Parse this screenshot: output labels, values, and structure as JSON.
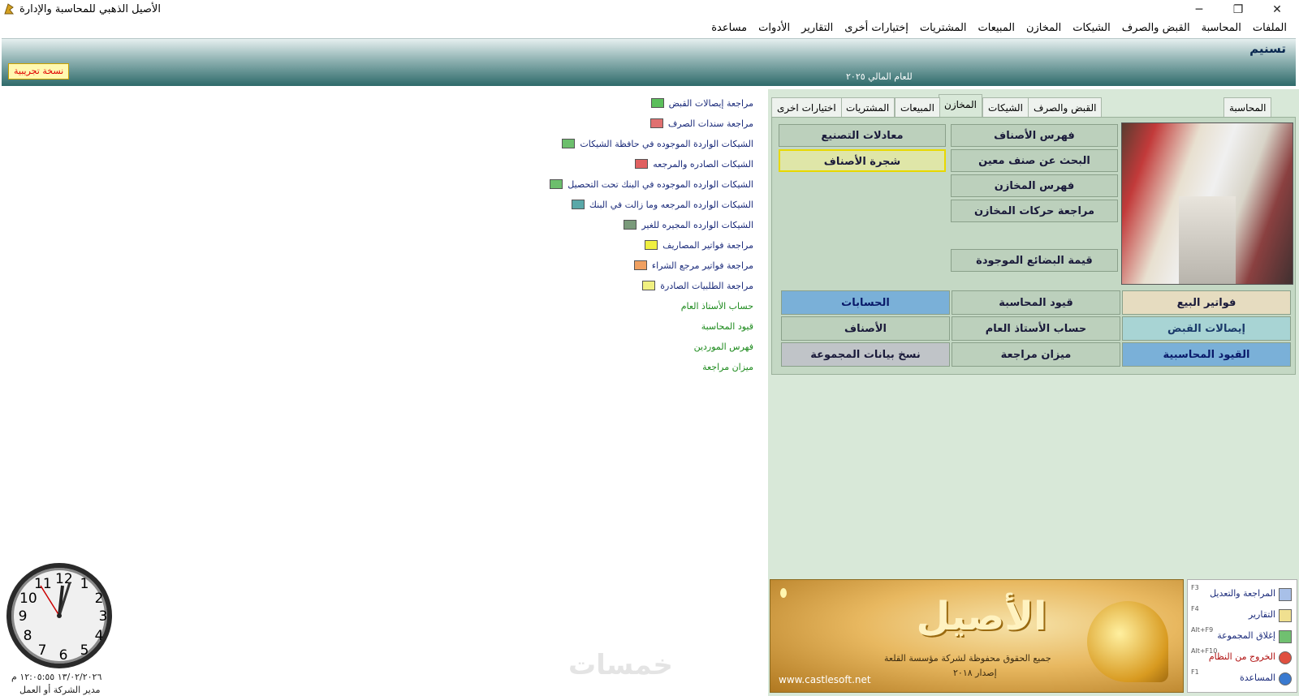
{
  "window": {
    "title": "الأصيل الذهبي للمحاسبة والإدارة",
    "minimize": "─",
    "maximize": "❐",
    "close": "✕"
  },
  "menu": [
    "الملفات",
    "المحاسبة",
    "القبض والصرف",
    "الشيكات",
    "المخازن",
    "المبيعات",
    "المشتريات",
    "إختيارات أخرى",
    "التقارير",
    "الأدوات",
    "مساعدة"
  ],
  "header": {
    "company": "تسنيم",
    "trial_badge": "نسخة تجريبية",
    "fiscal_year": "للعام المالي ٢٠٢٥"
  },
  "review_list": [
    {
      "label": "مراجعة إيصالات القبض",
      "icon": "green-grid-icon",
      "color": "#5cbf5c"
    },
    {
      "label": "مراجعة سندات الصرف",
      "icon": "red-grid-icon",
      "color": "#e07070"
    },
    {
      "label": "الشيكات الواردة الموجوده في حافظة الشيكات",
      "icon": "green-check-icon",
      "color": "#6cbf6c"
    },
    {
      "label": "الشيكات الصادره والمرجعه",
      "icon": "red-check-icon",
      "color": "#e06060"
    },
    {
      "label": "الشيكات الوارده الموجوده في البنك تحت التحصيل",
      "icon": "green-check-icon",
      "color": "#6cbf6c"
    },
    {
      "label": "الشيكات الوارده المرجعه وما زالت في البنك",
      "icon": "teal-check-icon",
      "color": "#5aa8a8"
    },
    {
      "label": "الشيكات الوارده المجيره للغير",
      "icon": "gray-check-icon",
      "color": "#7a9a7a"
    },
    {
      "label": "مراجعة فواتير المصاريف",
      "icon": "yellow-doc-icon",
      "color": "#f0f040"
    },
    {
      "label": "مراجعة فواتير مرجع الشراء",
      "icon": "orange-grid-icon",
      "color": "#f0a060"
    },
    {
      "label": "مراجعة  الطلبيات الصادرة",
      "icon": "yellow-doc-icon",
      "color": "#f0f080"
    }
  ],
  "quick_links": [
    "حساب الأستاذ العام",
    "قيود المحاسبة",
    "فهرس الموردين",
    "ميزان مراجعة"
  ],
  "tabs": [
    "المحاسبة",
    "القبض والصرف",
    "الشيكات",
    "المخازن",
    "المبيعات",
    "المشتريات",
    "اختيارات اخرى"
  ],
  "active_tab": "المخازن",
  "store_buttons": {
    "items_index": "فهرس الأصناف",
    "search_item": "البحث عن صنف معين",
    "stores_index": "فهرس المخازن",
    "stores_movements": "مراجعة حركات المخازن",
    "goods_value": "قيمة البضائع  الموجودة",
    "manufacturing": "معادلات التصنيع",
    "items_tree": "شجرة الأصناف"
  },
  "bottom_buttons": [
    [
      "فواتير البيع",
      "قيود المحاسبة",
      "الحسابات"
    ],
    [
      "إيصالات القبض",
      "حساب الأستاذ العام",
      "الأصناف"
    ],
    [
      "القيود المحاسبية",
      "ميزان مراجعة",
      "نسخ بيانات المجموعة"
    ]
  ],
  "banner": {
    "logo": "الأصيل",
    "rights": "جميع الحقوق محفوظة لشركة مؤسسة القلعة",
    "version": "إصدار ٢٠١٨",
    "url": "www.castlesoft.net"
  },
  "shortcuts": [
    {
      "label": "المراجعة والتعديل",
      "key": "F3",
      "icon": "review-icon"
    },
    {
      "label": "التقارير",
      "key": "F4",
      "icon": "reports-icon"
    },
    {
      "label": "إغلاق المجموعة",
      "key": "Alt+F9",
      "icon": "close-group-icon"
    },
    {
      "label": "الخروج من النظام",
      "key": "Alt+F10",
      "icon": "exit-icon"
    },
    {
      "label": "المساعدة",
      "key": "F1",
      "icon": "help-icon"
    }
  ],
  "clock": {
    "datetime": "١٣/٠٢/٢٠٢٦ ١٢:٠٥:٥٥ م",
    "user": "مدير الشركة أو العمل",
    "numerals": [
      "12",
      "1",
      "2",
      "3",
      "4",
      "5",
      "6",
      "7",
      "8",
      "9",
      "10",
      "11"
    ]
  },
  "watermark": "خمسات"
}
